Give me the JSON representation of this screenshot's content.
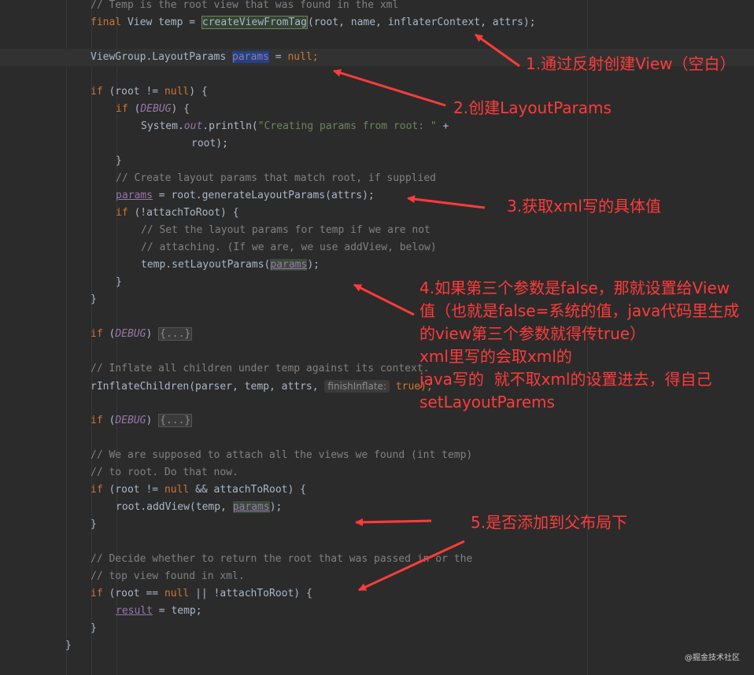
{
  "code": {
    "l1": "// Temp is the root view that was found in the xml",
    "l2": {
      "kw": "final",
      "a": " View temp = ",
      "fn": "createViewFromTag",
      "b": "(root, name, inflaterContext, attrs);"
    },
    "l3": {
      "a": "ViewGroup.LayoutParams ",
      "p": "params",
      "b": " = ",
      "n": "null",
      ";": ";"
    },
    "l4": {
      "kw": "if",
      "a": " (root != ",
      "n": "null",
      "b": ") {"
    },
    "l5": {
      "kw": "if",
      "a": " (",
      "d": "DEBUG",
      "b": ") {"
    },
    "l6": {
      "a": "System.",
      "o": "out",
      "b": ".println(",
      "s": "\"Creating params from root: \"",
      "c": " +"
    },
    "l7": "root);",
    "l8": "}",
    "l9": "// Create layout params that match root, if supplied",
    "l10": {
      "p": "params",
      "a": " = root.generateLayoutParams(attrs);"
    },
    "l11": {
      "kw": "if",
      "a": " (!attachToRoot) {"
    },
    "l12": "// Set the layout params for temp if we are not",
    "l13": "// attaching. (If we are, we use addView, below)",
    "l14": {
      "a": "temp.setLayoutParams(",
      "p": "params",
      "b": ");"
    },
    "l15": "}",
    "l16": "}",
    "l17": {
      "kw": "if",
      "a": " (",
      "d": "DEBUG",
      "b": ") ",
      "f": "{...}"
    },
    "l18": "// Inflate all children under temp against its context.",
    "l19": {
      "a": "rInflateChildren(parser, temp, attrs, ",
      "h": "finishInflate:",
      "b": " true);"
    },
    "l20": {
      "kw": "if",
      "a": " (",
      "d": "DEBUG",
      "b": ") ",
      "f": "{...}"
    },
    "l21": "// We are supposed to attach all the views we found (int temp)",
    "l22": "// to root. Do that now.",
    "l23": {
      "kw": "if",
      "a": " (root != ",
      "n": "null",
      "b": " && attachToRoot) {"
    },
    "l24": {
      "a": "root.addView(temp, ",
      "p": "params",
      "b": ");"
    },
    "l25": "}",
    "l26": "// Decide whether to return the root that was passed in or the",
    "l27": "// top view found in xml.",
    "l28": {
      "kw": "if",
      "a": " (root == ",
      "n": "null",
      "b": " || !attachToRoot) {"
    },
    "l29": {
      "r": "result",
      "a": " = temp;"
    },
    "l30": "}",
    "l31": "}"
  },
  "annotations": {
    "n1": "1.通过反射创建View（空白）",
    "n2": "2.创建LayoutParams",
    "n3": "3.获取xml写的具体值",
    "n4": "4.如果第三个参数是false，那就设置给View\n值（也就是false=系统的值，java代码里生成\n的view第三个参数就得传true）\nxml里写的会取xml的\njava写的  就不取xml的设置进去，得自己\nsetLayoutParems",
    "n5": "5.是否添加到父布局下"
  },
  "watermark": "@掘金技术社区",
  "colors": {
    "annotation": "#ff3b3b",
    "background": "#2b2b2b",
    "keyword": "#cc7832",
    "string": "#6a8759",
    "comment": "#808080"
  }
}
